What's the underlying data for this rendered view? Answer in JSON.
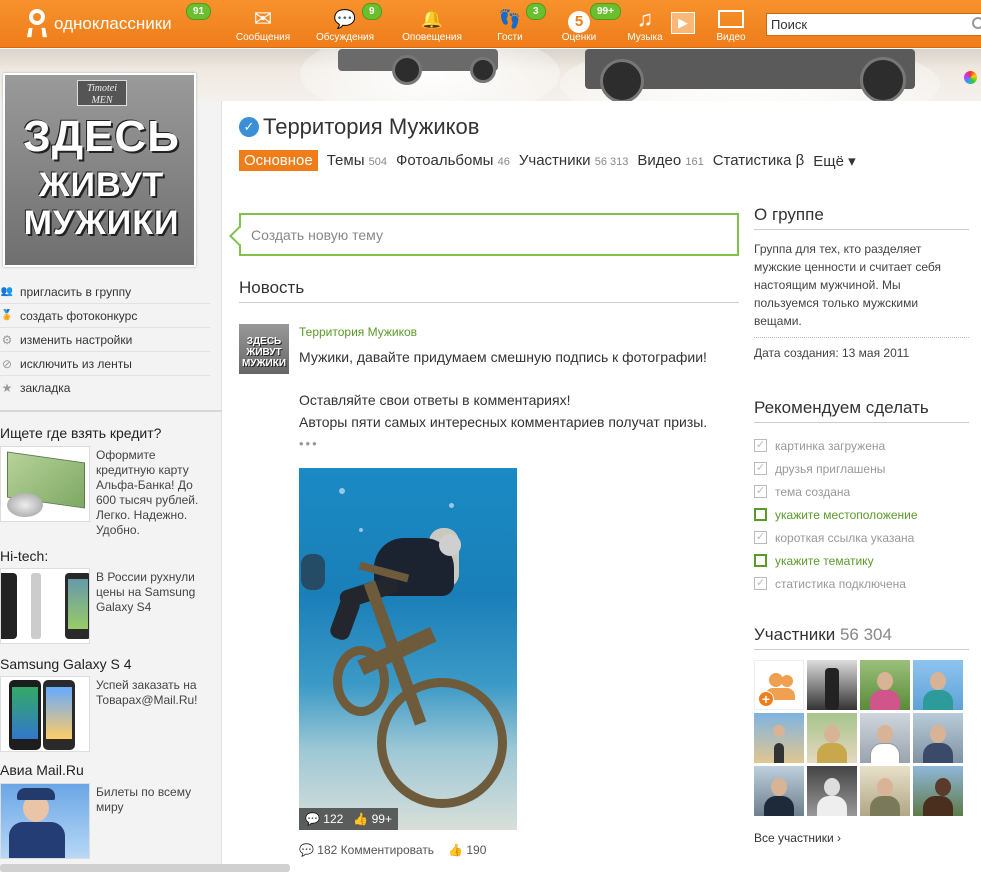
{
  "header": {
    "logo_text": "одноклассники",
    "logo_badge": "91",
    "nav": [
      {
        "label": "Сообщения",
        "icon": "envelope-icon",
        "glyph": "✉",
        "badge": ""
      },
      {
        "label": "Обсуждения",
        "icon": "chat-bubbles-icon",
        "glyph": "💬",
        "badge": "9"
      },
      {
        "label": "Оповещения",
        "icon": "bell-icon",
        "glyph": "🔔",
        "badge": ""
      },
      {
        "label": "Гости",
        "icon": "footprints-icon",
        "glyph": "👣",
        "badge": "3"
      },
      {
        "label": "Оценки",
        "icon": "rating-five-icon",
        "glyph": "5",
        "badge": "99+"
      },
      {
        "label": "Музыка",
        "icon": "music-note-icon",
        "glyph": "♫",
        "badge": ""
      },
      {
        "label": "Видео",
        "icon": "film-icon",
        "glyph": "▭",
        "badge": ""
      }
    ],
    "search_placeholder": "Поиск"
  },
  "poster": {
    "brand": "Timotei MEN",
    "line1": "ЗДЕСЬ",
    "line2": "ЖИВУТ",
    "line3": "МУЖИКИ"
  },
  "left_actions": [
    {
      "label": "пригласить в группу",
      "icon": "people-icon",
      "glyph": "👥"
    },
    {
      "label": "создать фотоконкурс",
      "icon": "medal-icon",
      "glyph": "🏅"
    },
    {
      "label": "изменить настройки",
      "icon": "gear-icon",
      "glyph": "⚙"
    },
    {
      "label": "исключить из ленты",
      "icon": "exclude-icon",
      "glyph": "⊘"
    },
    {
      "label": "закладка",
      "icon": "star-icon",
      "glyph": "★"
    }
  ],
  "ads": [
    {
      "title": "Ищете где взять кредит?",
      "text": "Оформите кредитную карту Альфа-Банка! До 600 тысяч рублей. Легко. Надежно. Удобно."
    },
    {
      "title": "Hi-tech:",
      "text": "В России рухнули цены на Samsung Galaxy S4"
    },
    {
      "title": "Samsung Galaxy S 4",
      "text": "Успей заказать на Товарах@Mail.Ru!"
    },
    {
      "title": "Авиа Mail.Ru",
      "text": "Билеты по всему миру"
    }
  ],
  "group": {
    "title": "Территория Мужиков",
    "tabs": [
      {
        "label": "Основное",
        "count": ""
      },
      {
        "label": "Темы",
        "count": "504"
      },
      {
        "label": "Фотоальбомы",
        "count": "46"
      },
      {
        "label": "Участники",
        "count": "56 313"
      },
      {
        "label": "Видео",
        "count": "161"
      },
      {
        "label": "Статистика β",
        "count": ""
      },
      {
        "label": "Ещё ▾",
        "count": ""
      }
    ],
    "compose_placeholder": "Создать новую тему"
  },
  "feed": {
    "heading": "Новость",
    "post": {
      "author": "Территория Мужиков",
      "line1": "Мужики, давайте придумаем смешную подпись к фотографии!",
      "line2": "Оставляйте свои ответы в комментариях!",
      "line3": "Авторы пяти самых интересных комментариев получат призы.",
      "more": "•••",
      "photo_comments": "122",
      "photo_likes": "99+",
      "footer_comments": "182 Комментировать",
      "footer_likes": "190"
    }
  },
  "about": {
    "heading": "О группе",
    "text": "Группа для тех, кто разделяет мужские ценности и считает себя настоящим мужчиной. Мы пользуемся только мужскими вещами.",
    "created": "Дата создания: 13 мая 2011"
  },
  "recommend": {
    "heading": "Рекомендуем сделать",
    "items": [
      {
        "label": "картинка загружена",
        "done": true
      },
      {
        "label": "друзья приглашены",
        "done": true
      },
      {
        "label": "тема создана",
        "done": true
      },
      {
        "label": "укажите местоположение",
        "done": false
      },
      {
        "label": "короткая ссылка указана",
        "done": true
      },
      {
        "label": "укажите тематику",
        "done": false
      },
      {
        "label": "статистика подключена",
        "done": true
      }
    ]
  },
  "members": {
    "heading": "Участники",
    "count": "56 304",
    "all_link": "Все участники ›"
  },
  "colors": {
    "brand_orange": "#ef7d1a",
    "badge_green": "#6abf2f",
    "link_green": "#5a9a2a",
    "verified_blue": "#3b8fd6"
  }
}
